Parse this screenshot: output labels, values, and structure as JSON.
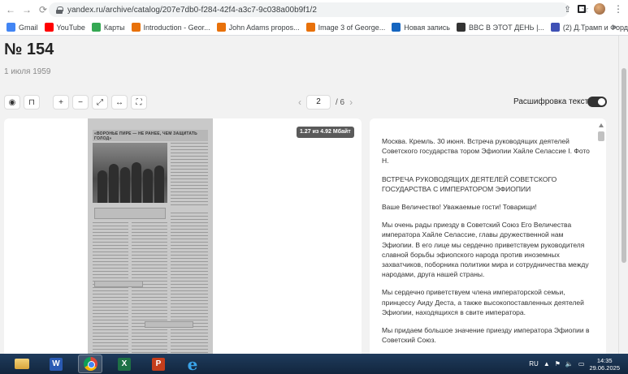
{
  "browser": {
    "url": "yandex.ru/archive/catalog/207e7db0-f284-42f4-a3c7-9c038a00b9f1/2",
    "bookmarks": [
      {
        "label": "Gmail",
        "icon": "gmail-icon",
        "color": "#4285f4"
      },
      {
        "label": "YouTube",
        "icon": "youtube-icon",
        "color": "#ff0000"
      },
      {
        "label": "Карты",
        "icon": "maps-icon",
        "color": "#34a853"
      },
      {
        "label": "Introduction - Geor...",
        "icon": "doc-icon",
        "color": "#e8710a"
      },
      {
        "label": "John Adams propos...",
        "icon": "doc-icon",
        "color": "#e8710a"
      },
      {
        "label": "Image 3 of George...",
        "icon": "doc-icon",
        "color": "#e8710a"
      },
      {
        "label": "Новая запись",
        "icon": "blog-icon",
        "color": "#1565c0"
      },
      {
        "label": "BBC В ЭТОТ ДЕНЬ |...",
        "icon": "globe-icon",
        "color": "#333333"
      },
      {
        "label": "(2) Д.Трамп и Форд...",
        "icon": "user-icon",
        "color": "#3f51b5"
      }
    ],
    "more": "»"
  },
  "page": {
    "title": "№ 154",
    "date": "1 июля 1959",
    "pager": {
      "current": "2",
      "total": "/ 6"
    },
    "decode_label": "Расшифровка текста",
    "size_badge": "1.27 из 4.92 Мбайт"
  },
  "newspaper": {
    "headline": "«ВОРОНЬЕ ПИРЕ — НЕ РАНЕЕ, ЧЕМ ЗАЩИТАТЬ ГОЛОД»"
  },
  "transcript": {
    "paragraphs": [
      "Москва. Кремль. 30 июня. Встреча руководящих деятелей Советского государства тором Эфиопии Хайле Селассие I. Фото Н.",
      "ВСТРЕЧА РУКОВОДЯЩИХ ДЕЯТЕЛЕЙ СОВЕТСКОГО ГОСУДАРСТВА С ИМПЕРАТОРОМ ЭФИОПИИ",
      "Ваше Величество! Уважаемые гости! Товарищи!",
      "Мы очень рады приезду в Советский Союз Его Величества императора Хайле Селассие, главы дружественной нам Эфиопии. В его лице мы сердечно приветствуем руководителя славной борьбы эфиопского народа против иноземных захватчиков, поборника политики мира и сотрудничества между народами, друга нашей страны.",
      "Мы сердечно приветствуем члена императорской семьи, принцессу Аиду Деста, а также высокопоставленных деятелей Эфиопии, находящихся в свите императора.",
      "Мы придаем большое значение приезду императора Эфиопии в Советский Союз."
    ]
  },
  "taskbar": {
    "lang": "RU",
    "time": "14:35",
    "date": "29.06.2025"
  }
}
